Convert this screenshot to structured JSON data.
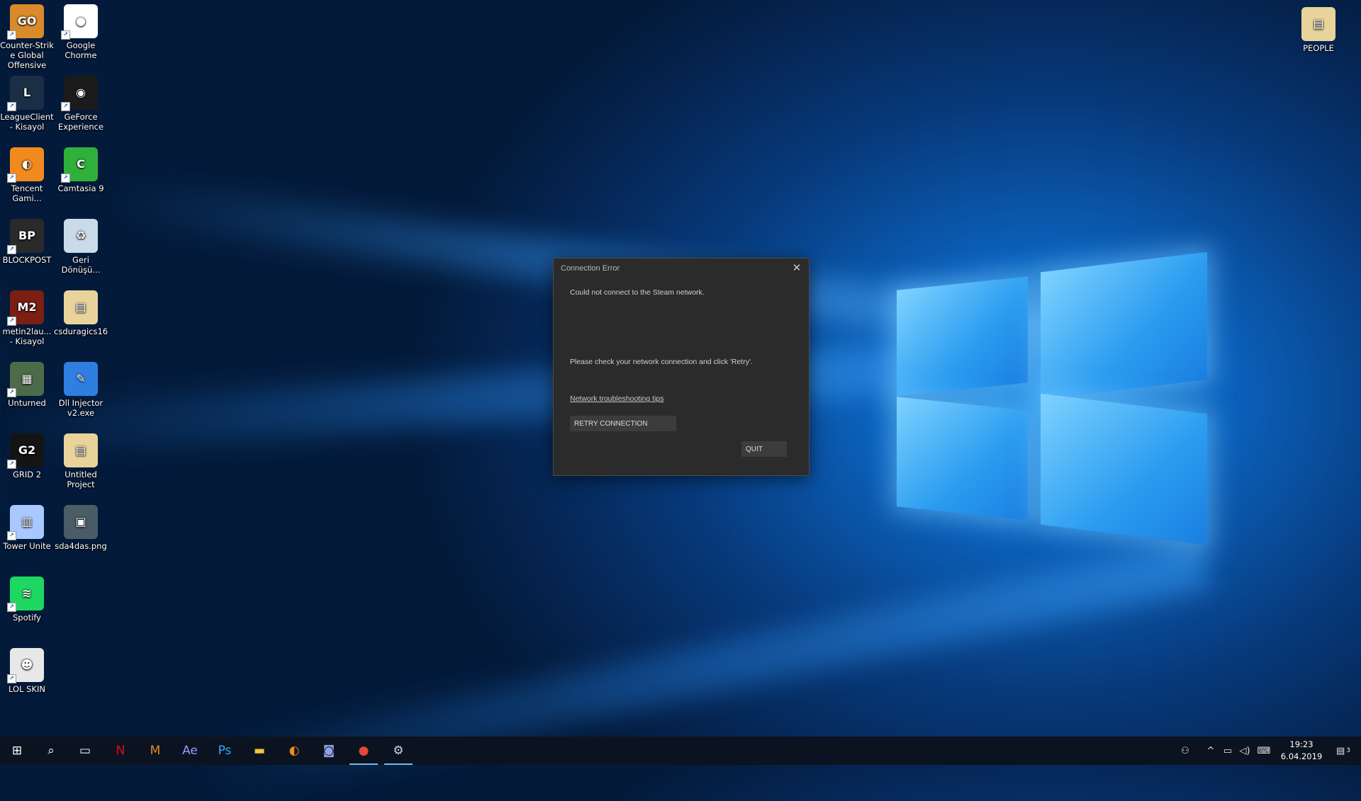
{
  "desktop": {
    "icons": [
      {
        "label": "Counter-Strik e Global Offensive",
        "glyph": "GO",
        "color": "#d98a2a",
        "icon": "csgo-icon"
      },
      {
        "label": "Google Chorme",
        "glyph": "●",
        "color": "#ffffff",
        "icon": "chrome-icon"
      },
      {
        "label": "LeagueClient - Kisayol",
        "glyph": "L",
        "color": "#1a2f45",
        "icon": "league-icon"
      },
      {
        "label": "GeForce Experience",
        "glyph": "◉",
        "color": "#1b1b1b",
        "icon": "geforce-icon"
      },
      {
        "label": "Tencent Gami...",
        "glyph": "◐",
        "color": "#f08a1e",
        "icon": "tencent-icon"
      },
      {
        "label": "Camtasia 9",
        "glyph": "C",
        "color": "#2fb03a",
        "icon": "camtasia-icon"
      },
      {
        "label": "BLOCKPOST",
        "glyph": "BP",
        "color": "#2a2a2a",
        "icon": "blockpost-icon"
      },
      {
        "label": "Geri Dönüşü...",
        "glyph": "♻",
        "color": "#c9dbe8",
        "icon": "recycle-bin-icon"
      },
      {
        "label": "metin2lau... - Kisayol",
        "glyph": "M2",
        "color": "#7a1f12",
        "icon": "metin2-icon"
      },
      {
        "label": "csduragics16",
        "glyph": "▤",
        "color": "#e8d49a",
        "icon": "folder-icon"
      },
      {
        "label": "Unturned",
        "glyph": "▦",
        "color": "#4d6b48",
        "icon": "unturned-icon"
      },
      {
        "label": "Dll Injector v2.exe",
        "glyph": "✎",
        "color": "#2f7fe0",
        "icon": "injector-icon"
      },
      {
        "label": "GRID 2",
        "glyph": "G2",
        "color": "#141414",
        "icon": "grid2-icon"
      },
      {
        "label": "Untitled Project",
        "glyph": "▤",
        "color": "#e8d49a",
        "icon": "project-icon"
      },
      {
        "label": "Tower Unite",
        "glyph": "▥",
        "color": "#a8c8ff",
        "icon": "tower-unite-icon"
      },
      {
        "label": "sda4das.png",
        "glyph": "▣",
        "color": "#4a5c66",
        "icon": "image-file-icon"
      },
      {
        "label": "Spotify",
        "glyph": "≋",
        "color": "#1ed760",
        "icon": "spotify-icon"
      },
      {
        "label": "LOL SKIN",
        "glyph": "☻",
        "color": "#e8e8e8",
        "icon": "lolskin-icon"
      }
    ],
    "people": {
      "label": "PEOPLE",
      "glyph": "▤",
      "color": "#e8d49a"
    }
  },
  "dialog": {
    "title": "Connection Error",
    "close": "✕",
    "message1": "Could not connect to the Steam network.",
    "message2": "Please check your network connection and click 'Retry'.",
    "link": "Network troubleshooting tips",
    "retry": "RETRY CONNECTION",
    "quit": "QUIT"
  },
  "taskbar": {
    "apps": [
      {
        "glyph": "⊞",
        "icon": "start-icon",
        "color": "#ffffff"
      },
      {
        "glyph": "⌕",
        "icon": "search-icon",
        "color": "#ffffff"
      },
      {
        "glyph": "▭",
        "icon": "task-view-icon",
        "color": "#ffffff"
      },
      {
        "glyph": "N",
        "icon": "netflix-icon",
        "color": "#e50914"
      },
      {
        "glyph": "M",
        "icon": "metin2-icon",
        "color": "#e08a2a"
      },
      {
        "glyph": "Ae",
        "icon": "after-effects-icon",
        "color": "#9999ff"
      },
      {
        "glyph": "Ps",
        "icon": "photoshop-icon",
        "color": "#31a8ff"
      },
      {
        "glyph": "▬",
        "icon": "file-explorer-icon",
        "color": "#f3c443"
      },
      {
        "glyph": "◐",
        "icon": "tencent-icon",
        "color": "#f08a1e"
      },
      {
        "glyph": "◙",
        "icon": "discord-icon",
        "color": "#8ea1e1"
      },
      {
        "glyph": "●",
        "icon": "chrome-icon",
        "color": "#e04a3a"
      },
      {
        "glyph": "⚙",
        "icon": "steam-icon",
        "color": "#c6d4df"
      }
    ],
    "tray": {
      "people": "⚇",
      "chevron": "^",
      "network": "▭",
      "volume": "◁)",
      "keyboard": "⌨",
      "time": "19:23",
      "date": "6.04.2019",
      "notifications": "▤",
      "notification_count": "3"
    }
  }
}
